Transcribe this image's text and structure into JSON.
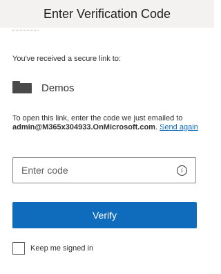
{
  "header": {
    "title": "Enter Verification Code"
  },
  "intro": {
    "received_text": "You've received a secure link to:"
  },
  "item": {
    "name": "Demos",
    "icon": "folder-icon"
  },
  "instructions": {
    "prefix": "To open this link, enter the code we just emailed to ",
    "email": "admin@M365x304933.OnMicrosoft.com",
    "suffix": ". ",
    "send_again": "Send again"
  },
  "code_input": {
    "placeholder": "Enter code",
    "value": ""
  },
  "verify_button": {
    "label": "Verify"
  },
  "keep_signed_in": {
    "label": "Keep me signed in",
    "checked": false
  },
  "colors": {
    "accent": "#0f6cbd",
    "header_bg": "#f3f2f1"
  }
}
